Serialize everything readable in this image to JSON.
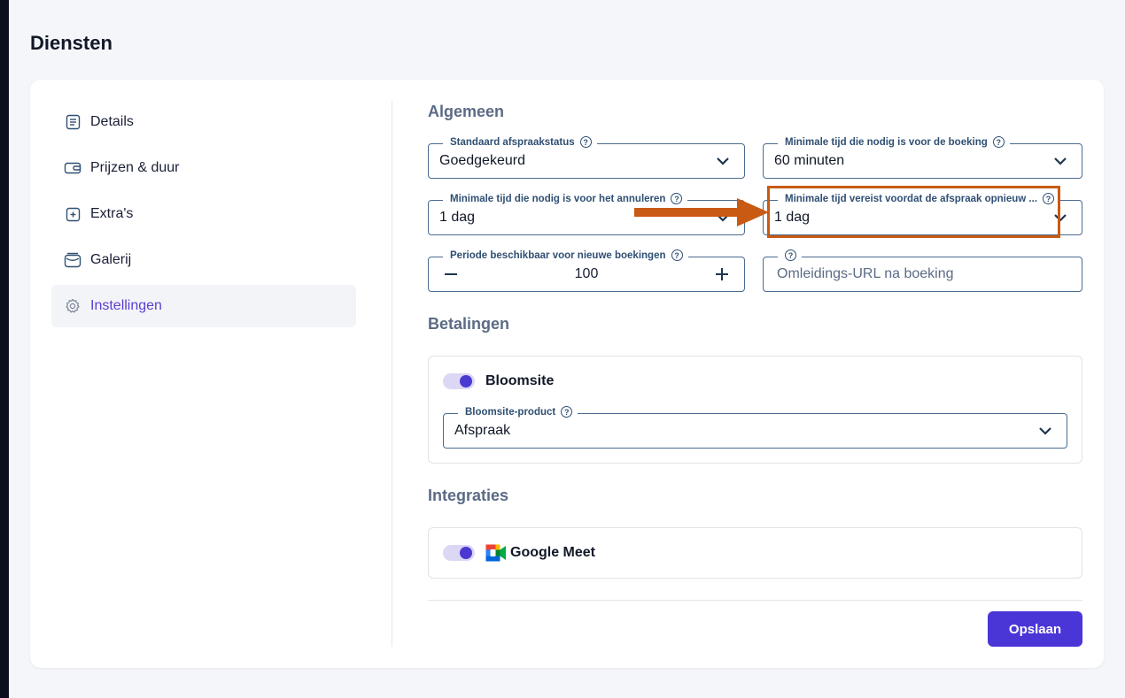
{
  "page": {
    "title": "Diensten"
  },
  "sidebar": {
    "items": [
      {
        "label": "Details",
        "icon": "document-icon"
      },
      {
        "label": "Prijzen & duur",
        "icon": "wallet-icon"
      },
      {
        "label": "Extra's",
        "icon": "plus-square-icon"
      },
      {
        "label": "Galerij",
        "icon": "gallery-icon"
      },
      {
        "label": "Instellingen",
        "icon": "gear-icon",
        "active": true
      }
    ]
  },
  "general": {
    "title": "Algemeen",
    "status_label": "Standaard afspraakstatus",
    "status_value": "Goedgekeurd",
    "min_booking_label": "Minimale tijd die nodig is voor de boeking",
    "min_booking_value": "60 minuten",
    "min_cancel_label": "Minimale tijd die nodig is voor het annuleren",
    "min_cancel_value": "1 dag",
    "min_reschedule_label": "Minimale tijd vereist voordat de afspraak opnieuw ...",
    "min_reschedule_value": "1 dag",
    "period_label": "Periode beschikbaar voor nieuwe boekingen",
    "period_value": "100",
    "redirect_placeholder": "Omleidings-URL na boeking"
  },
  "payments": {
    "title": "Betalingen",
    "provider": "Bloomsite",
    "product_label": "Bloomsite-product",
    "product_value": "Afspraak",
    "enabled": true
  },
  "integrations": {
    "title": "Integraties",
    "google_meet": "Google Meet",
    "enabled": true
  },
  "actions": {
    "save_label": "Opslaan"
  },
  "colors": {
    "accent": "#4a35d6",
    "highlight": "#c95a13",
    "field_border": "#4a6a8f"
  }
}
